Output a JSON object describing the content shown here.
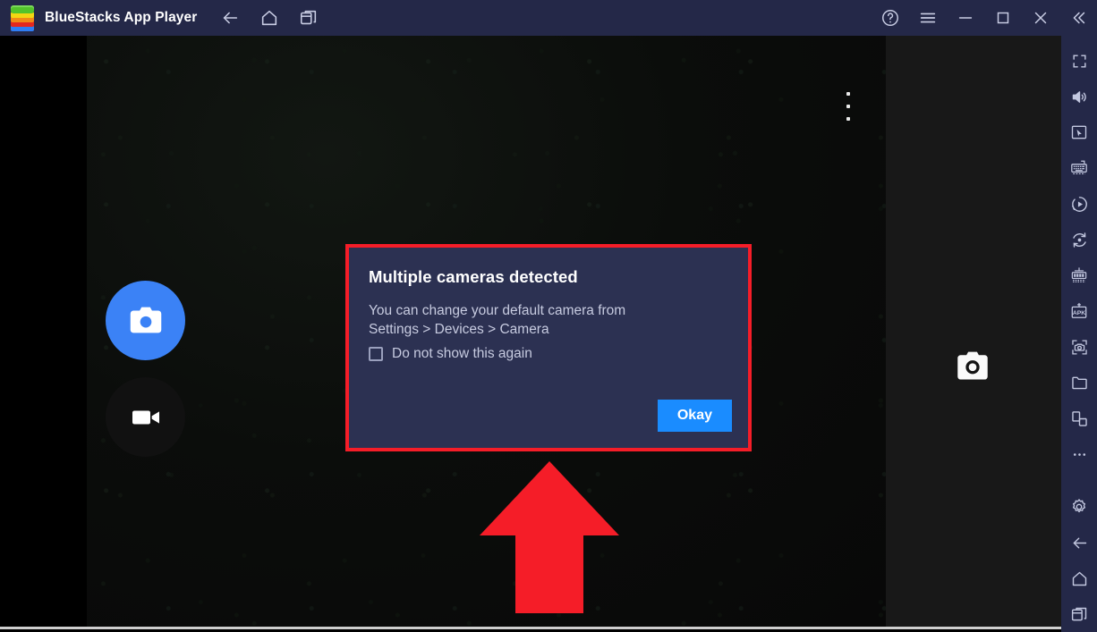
{
  "window": {
    "title": "BlueStacks App Player",
    "logo": "bluestacks-logo",
    "nav": [
      {
        "name": "back-icon",
        "label": "Back"
      },
      {
        "name": "home-icon",
        "label": "Home"
      },
      {
        "name": "multitask-icon",
        "label": "Recent apps"
      }
    ],
    "controls": [
      {
        "name": "help-icon",
        "label": "Help"
      },
      {
        "name": "menu-icon",
        "label": "Menu"
      },
      {
        "name": "minimize-icon",
        "label": "Minimize"
      },
      {
        "name": "maximize-icon",
        "label": "Maximize"
      },
      {
        "name": "close-icon",
        "label": "Close"
      },
      {
        "name": "collapse-icon",
        "label": "Collapse sidebar"
      }
    ],
    "colors": {
      "titlebar": "#242848",
      "sidebar": "#242848",
      "dialog_bg": "#2c3152",
      "accent_blue": "#1a8cff",
      "highlight_red": "#f51d28",
      "shutter_blue": "#3b82f6"
    }
  },
  "app": {
    "name": "camera-app",
    "overflow_menu": "more-options-icon",
    "shutter_button": "camera-shutter-button",
    "video_button": "video-record-button",
    "preview_thumb": "camera-icon"
  },
  "dialog": {
    "title": "Multiple cameras detected",
    "body_line1": "You can change your default camera from",
    "body_line2": "Settings > Devices > Camera",
    "checkbox_label": "Do not show this again",
    "checkbox_checked": false,
    "confirm_label": "Okay"
  },
  "annotation": {
    "arrow": "red-up-arrow",
    "highlight": "red-rectangle-outline"
  },
  "sidebar": {
    "items": [
      {
        "name": "fullscreen-icon",
        "label": "Full screen"
      },
      {
        "name": "volume-icon",
        "label": "Volume"
      },
      {
        "name": "pointer-box-icon",
        "label": "Game controls"
      },
      {
        "name": "keyboard-icon",
        "label": "Keyboard controls"
      },
      {
        "name": "macro-record-icon",
        "label": "Macro recorder"
      },
      {
        "name": "script-record-icon",
        "label": "Script recorder"
      },
      {
        "name": "multi-instance-icon",
        "label": "Multi-instance manager"
      },
      {
        "name": "install-apk-icon",
        "label": "Install APK"
      },
      {
        "name": "screenshot-icon",
        "label": "Screenshot"
      },
      {
        "name": "media-folder-icon",
        "label": "Media manager"
      },
      {
        "name": "rotate-screen-icon",
        "label": "Rotate"
      },
      {
        "name": "more-icon",
        "label": "More"
      }
    ],
    "bottom_items": [
      {
        "name": "settings-gear-icon",
        "label": "Settings"
      },
      {
        "name": "back-arrow-icon",
        "label": "Back"
      },
      {
        "name": "home-icon",
        "label": "Home"
      },
      {
        "name": "recent-apps-icon",
        "label": "Recent apps"
      }
    ]
  }
}
